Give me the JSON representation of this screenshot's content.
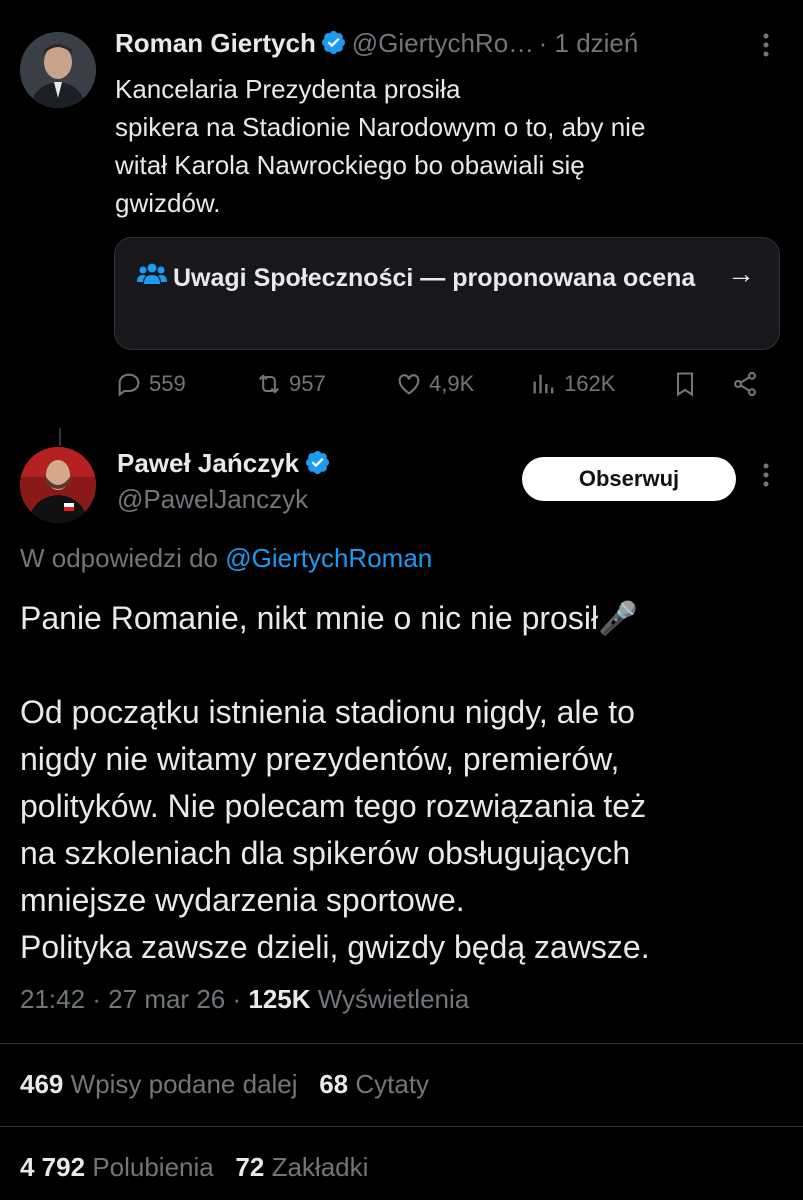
{
  "tweet1": {
    "author_name": "Roman Giertych",
    "handle": "@GiertychRo…",
    "time": "· 1 dzień",
    "text_lines": [
      "Kancelaria Prezydenta prosiła",
      "spikera na Stadionie Narodowym o to, aby nie",
      "witał Karola Nawrockiego bo obawiali się",
      "gwizdów."
    ],
    "community_note": {
      "label": "Uwagi Społeczności — proponowana ocena",
      "icon": "people-icon",
      "accent": "#1d9bf0"
    },
    "actions": {
      "replies": "559",
      "retweets": "957",
      "likes": "4,9K",
      "views": "162K"
    }
  },
  "tweet2": {
    "author_name": "Paweł Jańczyk",
    "handle": "@PawelJanczyk",
    "follow_label": "Obserwuj",
    "replying_prefix": "W odpowiedzi do",
    "replying_to": "@GiertychRoman",
    "paragraph1": "Panie Romanie, nikt mnie o nic nie prosił🎤",
    "body_lines": [
      "Od początku istnienia stadionu nigdy, ale to",
      "nigdy nie witamy prezydentów, premierów,",
      "polityków. Nie polecam tego rozwiązania też",
      "na szkoleniach dla spikerów obsługujących",
      "mniejsze wydarzenia sportowe.",
      "Polityka zawsze dzieli, gwizdy będą zawsze."
    ],
    "time": "21:42 · 27 mar 26 ·",
    "views_count": "125K",
    "views_label": "Wyświetlenia",
    "stats": {
      "retweets_count": "469",
      "retweets_label": "Wpisy podane dalej",
      "quotes_count": "68",
      "quotes_label": "Cytaty",
      "likes_count": "4 792",
      "likes_label": "Polubienia",
      "bookmarks_count": "72",
      "bookmarks_label": "Zakładki"
    }
  },
  "colors": {
    "background": "#000000",
    "text": "#e7e9ea",
    "muted": "#71767b",
    "link": "#1d9bf0",
    "verified": "#1d9bf0"
  }
}
